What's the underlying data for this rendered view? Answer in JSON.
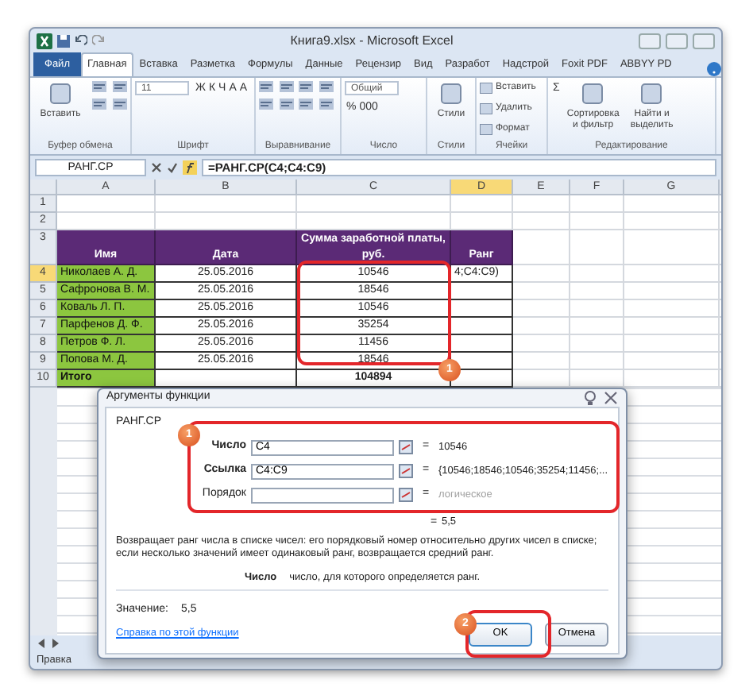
{
  "window": {
    "title": "Книга9.xlsx - Microsoft Excel"
  },
  "tabs": [
    {
      "label": "Файл",
      "selected": false,
      "kind": "file"
    },
    {
      "label": "Главная",
      "selected": true,
      "kind": "tab"
    },
    {
      "label": "Вставка",
      "selected": false,
      "kind": "tab"
    },
    {
      "label": "Разметка",
      "selected": false,
      "kind": "tab"
    },
    {
      "label": "Формулы",
      "selected": false,
      "kind": "tab"
    },
    {
      "label": "Данные",
      "selected": false,
      "kind": "tab"
    },
    {
      "label": "Рецензир",
      "selected": false,
      "kind": "tab"
    },
    {
      "label": "Вид",
      "selected": false,
      "kind": "tab"
    },
    {
      "label": "Разработ",
      "selected": false,
      "kind": "tab"
    },
    {
      "label": "Надстрой",
      "selected": false,
      "kind": "tab"
    },
    {
      "label": "Foxit PDF",
      "selected": false,
      "kind": "tab"
    },
    {
      "label": "ABBYY PD",
      "selected": false,
      "kind": "tab"
    }
  ],
  "ribbon": [
    {
      "label": "Буфер обмена",
      "items": [
        {
          "kind": "big",
          "label": "Вставить"
        },
        {
          "kind": "icons"
        }
      ]
    },
    {
      "label": "Шрифт",
      "items": [
        {
          "kind": "field",
          "value": "11"
        },
        {
          "kind": "glyphs",
          "glyphs": [
            "Ж",
            "К",
            "Ч",
            "A",
            "A"
          ]
        }
      ]
    },
    {
      "label": "Выравнивание",
      "items": [
        {
          "kind": "icons"
        },
        {
          "kind": "icons"
        }
      ]
    },
    {
      "label": "Число",
      "items": [
        {
          "kind": "field",
          "value": "Общий"
        },
        {
          "kind": "glyphs",
          "glyphs": [
            "%",
            "000"
          ]
        }
      ]
    },
    {
      "label": "Стили",
      "items": [
        {
          "kind": "big",
          "label": "Стили"
        }
      ]
    },
    {
      "label": "Ячейки",
      "items": [
        {
          "kind": "small",
          "label": "Вставить"
        },
        {
          "kind": "small",
          "label": "Удалить"
        },
        {
          "kind": "small",
          "label": "Формат"
        }
      ]
    },
    {
      "label": "Редактирование",
      "items": [
        {
          "kind": "glyphs",
          "glyphs": [
            "Σ"
          ]
        },
        {
          "kind": "big",
          "label": "Сортировка и фильтр"
        },
        {
          "kind": "big",
          "label": "Найти и выделить"
        }
      ]
    }
  ],
  "formula_bar": {
    "name_box": "РАНГ.СР",
    "formula": "=РАНГ.СР(C4;C4:C9)"
  },
  "columns": [
    {
      "label": "A",
      "selected": false
    },
    {
      "label": "B",
      "selected": false
    },
    {
      "label": "C",
      "selected": false
    },
    {
      "label": "D",
      "selected": true
    },
    {
      "label": "E",
      "selected": false
    },
    {
      "label": "F",
      "selected": false
    },
    {
      "label": "G",
      "selected": false
    }
  ],
  "rows": [
    {
      "number": "1",
      "kind": "empty",
      "selected": false,
      "cells": []
    },
    {
      "number": "2",
      "kind": "empty",
      "selected": false,
      "cells": []
    },
    {
      "number": "3",
      "kind": "header",
      "selected": false,
      "cells": [
        "Имя",
        "Дата",
        "Сумма заработной платы, руб.",
        "Ранг"
      ]
    },
    {
      "number": "4",
      "kind": "data",
      "selected": true,
      "cells": [
        "Николаев А. Д.",
        "25.05.2016",
        "10546",
        "4;C4:C9)"
      ]
    },
    {
      "number": "5",
      "kind": "data",
      "selected": false,
      "cells": [
        "Сафронова В. М.",
        "25.05.2016",
        "18546",
        ""
      ]
    },
    {
      "number": "6",
      "kind": "data",
      "selected": false,
      "cells": [
        "Коваль Л. П.",
        "25.05.2016",
        "10546",
        ""
      ]
    },
    {
      "number": "7",
      "kind": "data",
      "selected": false,
      "cells": [
        "Парфенов Д. Ф.",
        "25.05.2016",
        "35254",
        ""
      ]
    },
    {
      "number": "8",
      "kind": "data",
      "selected": false,
      "cells": [
        "Петров Ф. Л.",
        "25.05.2016",
        "11456",
        ""
      ]
    },
    {
      "number": "9",
      "kind": "data",
      "selected": false,
      "cells": [
        "Попова М. Д.",
        "25.05.2016",
        "18546",
        ""
      ]
    },
    {
      "number": "10",
      "kind": "total",
      "selected": false,
      "cells": [
        "Итого",
        "",
        "104894",
        ""
      ]
    }
  ],
  "dialog": {
    "title": "Аргументы функции",
    "function": "РАНГ.СР",
    "arguments": [
      {
        "label": "Число",
        "value": "C4",
        "equals": "=",
        "result": "10546",
        "required": true
      },
      {
        "label": "Ссылка",
        "value": "C4:C9",
        "equals": "=",
        "result": "{10546;18546;10546;35254;11456;...",
        "required": true
      },
      {
        "label": "Порядок",
        "equals": "=",
        "result": "логическое",
        "required": false
      }
    ],
    "result_equals": "=",
    "result": "5,5",
    "description": "Возвращает ранг числа в списке чисел: его порядковый номер относительно других чисел в списке; если несколько значений имеет одинаковый ранг, возвращается средний ранг.",
    "arg_help_label": "Число",
    "arg_help": "число, для которого определяется ранг.",
    "value_label": "Значение:",
    "value": "5,5",
    "help_link": "Справка по этой функции",
    "buttons": [
      {
        "label": "OK",
        "kind": "default"
      },
      {
        "label": "Отмена",
        "kind": "normal"
      }
    ]
  },
  "callouts": [
    {
      "number": "1"
    },
    {
      "number": "1"
    },
    {
      "number": "2"
    }
  ],
  "status_bar": {
    "mode": "Правка"
  }
}
